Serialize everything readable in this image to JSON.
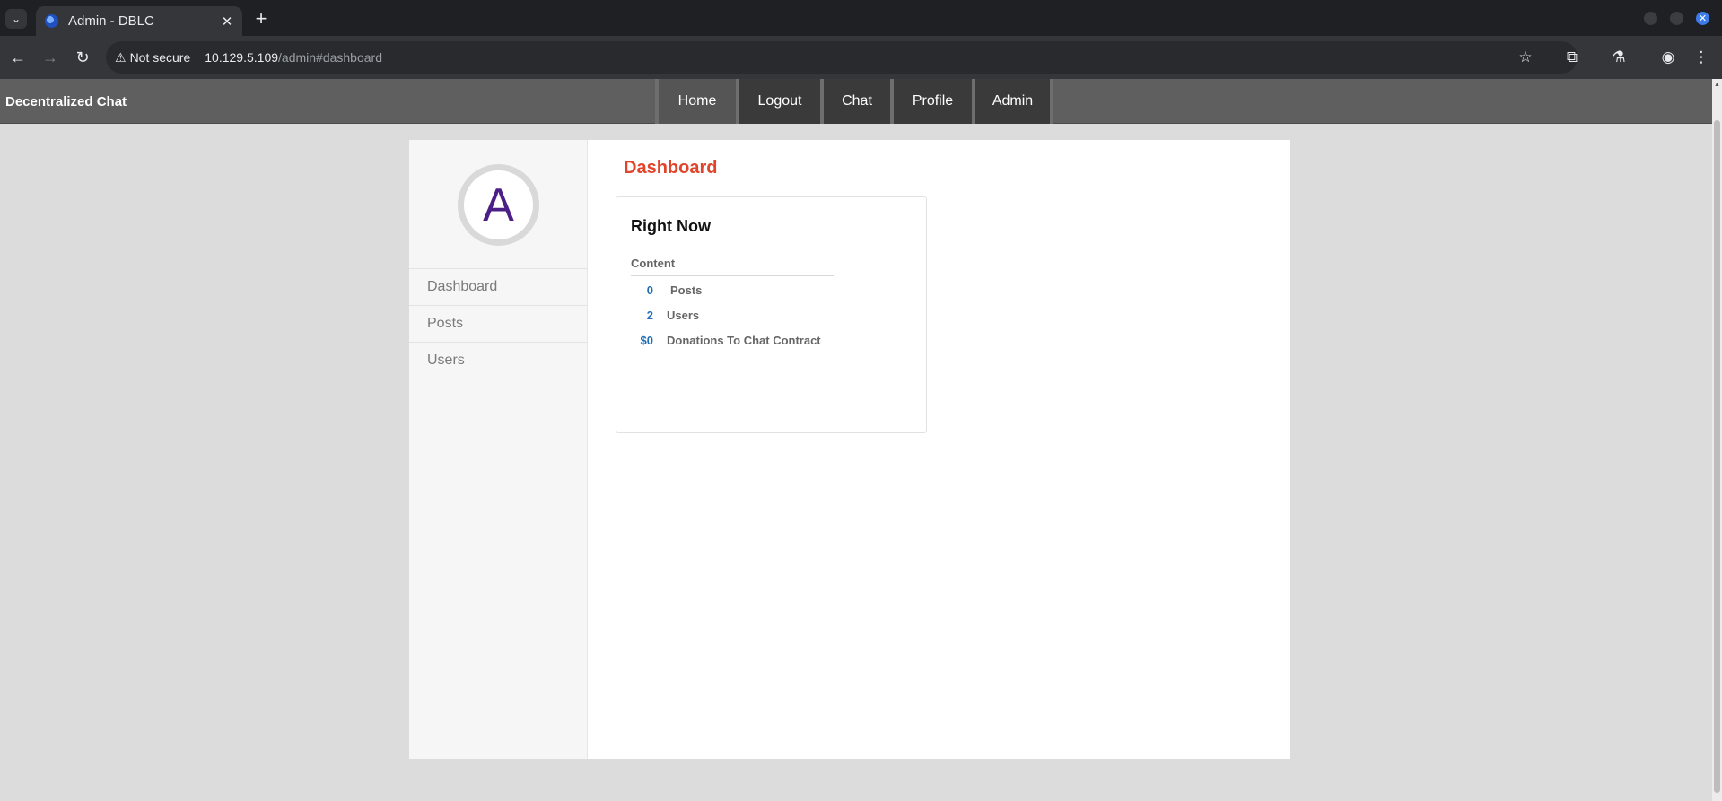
{
  "browser": {
    "tab_title": "Admin - DBLC",
    "security_label": "Not secure",
    "url_host": "10.129.5.109",
    "url_path": "/admin#dashboard"
  },
  "site": {
    "brand": "Decentralized Chat",
    "nav": [
      "Home",
      "Logout",
      "Chat",
      "Profile",
      "Admin"
    ]
  },
  "sidebar": {
    "avatar_letter": "A",
    "items": [
      "Dashboard",
      "Posts",
      "Users"
    ]
  },
  "main": {
    "title": "Dashboard",
    "card": {
      "title": "Right Now",
      "section": "Content",
      "stats": [
        {
          "value": "0",
          "label": "Posts"
        },
        {
          "value": "2",
          "label": "Users"
        },
        {
          "value": "$0",
          "label": "Donations To Chat Contract"
        }
      ]
    }
  },
  "colors": {
    "title_accent": "#e0452b",
    "stat_number": "#1f6fb8",
    "avatar_letter": "#4b1f86",
    "header_bg": "#5f5f5f"
  }
}
